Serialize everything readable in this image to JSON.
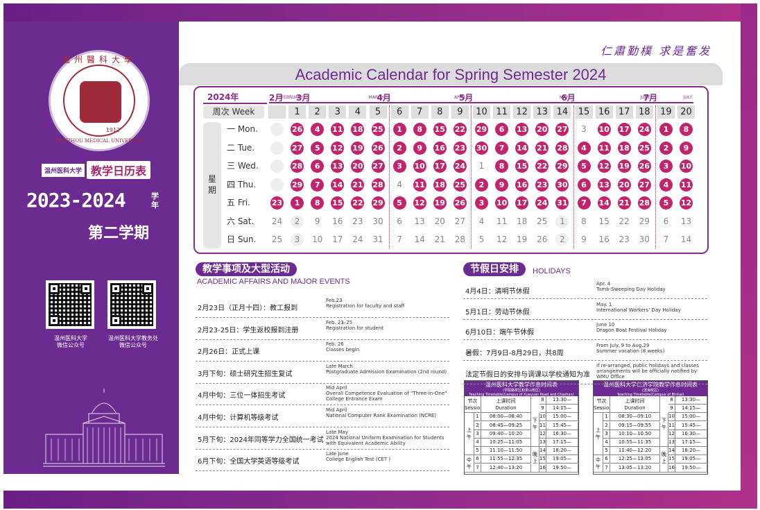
{
  "slogan": "仁肅勤樸  求是奮发",
  "side": {
    "seal_name_cn": "温州醫科大學",
    "seal_name_en": "WENZHOU MEDICAL UNIVERSITY",
    "seal_year": "1912",
    "tag_small": "温州医科大学",
    "tag_big": "教学日历表",
    "year_range": "2023-2024",
    "year_unit": "学年",
    "term": "第二学期",
    "qr_captions": [
      "温州医科大学\n微信公众号",
      "温州医科大学教务处\n微信公众号"
    ]
  },
  "calendar": {
    "title": "Academic Calendar for Spring Semester 2024",
    "year_label": "2024年",
    "week_label": "周次 Week",
    "side_label": "星期",
    "months": [
      {
        "cn": "2月",
        "en": "FEBRUARY"
      },
      {
        "cn": "3月",
        "en": "MARCH"
      },
      {
        "cn": "4月",
        "en": "APRIL"
      },
      {
        "cn": "5月",
        "en": "MAY"
      },
      {
        "cn": "6月",
        "en": "JUNE"
      },
      {
        "cn": "7月",
        "en": "JULY"
      }
    ],
    "weeks": [
      "",
      "1",
      "2",
      "3",
      "4",
      "5",
      "6",
      "7",
      "8",
      "9",
      "10",
      "11",
      "12",
      "13",
      "14",
      "15",
      "16",
      "17",
      "18",
      "19",
      "20"
    ],
    "day_names": [
      "一 Mon.",
      "二 Tue.",
      "三 Wed.",
      "四 Thu.",
      "五 Fri.",
      "六 Sat.",
      "日 Sun."
    ],
    "rows": [
      [
        "",
        "26",
        "4",
        "11",
        "18",
        "25",
        "1",
        "8",
        "15",
        "22",
        "29",
        "6",
        "13",
        "20",
        "27",
        "3",
        "10",
        "17",
        "24",
        "1",
        "8"
      ],
      [
        "",
        "27",
        "5",
        "12",
        "19",
        "26",
        "2",
        "9",
        "16",
        "23",
        "30",
        "7",
        "14",
        "21",
        "28",
        "4",
        "11",
        "18",
        "25",
        "2",
        "9"
      ],
      [
        "",
        "28",
        "6",
        "13",
        "20",
        "27",
        "3",
        "10",
        "17",
        "24",
        "1",
        "8",
        "15",
        "22",
        "29",
        "5",
        "12",
        "19",
        "26",
        "3",
        "10"
      ],
      [
        "",
        "29",
        "7",
        "14",
        "21",
        "28",
        "4",
        "11",
        "18",
        "25",
        "2",
        "9",
        "16",
        "23",
        "30",
        "6",
        "13",
        "20",
        "27",
        "4",
        "11"
      ],
      [
        "23",
        "1",
        "8",
        "15",
        "22",
        "29",
        "5",
        "12",
        "19",
        "26",
        "3",
        "10",
        "17",
        "24",
        "31",
        "7",
        "14",
        "21",
        "28",
        "5",
        "12"
      ],
      [
        "24",
        "2",
        "9",
        "16",
        "23",
        "30",
        "6",
        "13",
        "20",
        "27",
        "4",
        "11",
        "18",
        "25",
        "1",
        "8",
        "15",
        "22",
        "29",
        "6",
        "13"
      ],
      [
        "25",
        "3",
        "10",
        "17",
        "24",
        "31",
        "7",
        "14",
        "21",
        "28",
        "5",
        "12",
        "19",
        "26",
        "2",
        "9",
        "16",
        "23",
        "30",
        "7",
        "14"
      ]
    ]
  },
  "events": {
    "title_cn": "教学事项及大型活动",
    "title_en": "ACADEMIC AFFAIRS AND MAJOR EVENTS",
    "items": [
      {
        "cn": "2月23日（正月十四）：教工报到",
        "en": "Feb.23\nRegistration for faculty and staff"
      },
      {
        "cn": "2月23-25日：学生返校报到注册",
        "en": "Feb. 23–25\nRegistration for  student"
      },
      {
        "cn": "2月26日：正式上课",
        "en": "Feb. 26\nClasses begin"
      },
      {
        "cn": "3月下旬：硕士研究生招生复试",
        "en": "Late March\nPostgraduate Admission Examination (2nd round)"
      },
      {
        "cn": "4月中旬：三位一体招生考试",
        "en": "Mid April\nOverall Competence Evaluation of \"Three-in-One\"\nCollege Entrance  Exam"
      },
      {
        "cn": "4月中旬：计算机等级考试",
        "en": "Mid April\nNational Computer Rank Examination (NCRE)"
      },
      {
        "cn": "5月下旬：2024年同等学力全国统一考试",
        "en": "Late May\n2024 National Uniform Examination for Students\nwith Equivalent Academic Ability"
      },
      {
        "cn": "6月下旬：全国大学英语等级考试",
        "en": "Late June\nCollege English Test (CET )"
      }
    ]
  },
  "holidays": {
    "title_cn": "节假日安排",
    "title_en": "HOLIDAYS",
    "items": [
      {
        "cn": "4月4日：清明节休假",
        "en": "Apr. 4\nTomb-Sweeping Day Holiday"
      },
      {
        "cn": "5月1日：劳动节休假",
        "en": "May. 1\nInternational Workers' Day Holiday"
      },
      {
        "cn": "6月10日：端午节休假",
        "en": "June 10\nDragon Boat Festival Holiday"
      },
      {
        "cn": "暑假：7月9日-8月29日，共8周",
        "en": "From July. 9  to Aug.29\nSummer vocation  (8 weeks)"
      },
      {
        "cn": "法定节假日的安排与调课以学校通知为准",
        "en": "If re-arranged, public holidays and classes\narrangements will be officially notified by\nWMU Office"
      }
    ]
  },
  "timetables": [
    {
      "title": "温州医科大学教学作息时间表",
      "subtitle1": "(学院路校区和茶山校区)",
      "subtitle2": "Teaching Timetable(Campus of Xueyuan Road and Chashan)",
      "head": [
        "节次 Session",
        "上课时间 Duration"
      ],
      "am_label": "上午",
      "pm_label": "下午",
      "noon_label": "中午",
      "eve_label": "晚上",
      "left": [
        [
          "1",
          "08:00—08:40"
        ],
        [
          "2",
          "08:45—09:25"
        ],
        [
          "3",
          "09:40—10:20"
        ],
        [
          "4",
          "10:25—11:05"
        ],
        [
          "5",
          "11:10—11:50"
        ],
        [
          "6",
          "11:55—12:35"
        ],
        [
          "7",
          "12:40—13:20"
        ]
      ],
      "right": [
        [
          "8",
          "13:30—14:10"
        ],
        [
          "9",
          "14:15—14:55"
        ],
        [
          "10",
          "15:00—15:40"
        ],
        [
          "11",
          "15:45—16:25"
        ],
        [
          "12",
          "16:30—17:10"
        ],
        [
          "13",
          "17:15—17:55"
        ],
        [
          "14",
          "18:20—19:00"
        ],
        [
          "15",
          "19:05—19:45"
        ],
        [
          "16",
          "19:50—20:30"
        ]
      ]
    },
    {
      "title": "温州医科大学仁济学院教学作息时间表",
      "subtitle1": "(滨海校区)",
      "subtitle2": "Teaching Timetable(Campus of Binhai)",
      "head": [
        "节次 Session",
        "上课时间 Duration"
      ],
      "am_label": "上午",
      "pm_label": "下午",
      "noon_label": "中午",
      "eve_label": "晚上",
      "left": [
        [
          "1",
          "08:30—09:10"
        ],
        [
          "2",
          "09:15—09:55"
        ],
        [
          "3",
          "10:10—10:50"
        ],
        [
          "4",
          "10:55—11:35"
        ],
        [
          "5",
          "11:40—12:20"
        ],
        [
          "6",
          "12:25—13:05"
        ],
        [
          "7",
          "13:05—13:20"
        ]
      ],
      "right": [
        [
          "8",
          "13:30—14:10"
        ],
        [
          "9",
          "14:15—14:55"
        ],
        [
          "10",
          "15:00—15:40"
        ],
        [
          "11",
          "15:45—16:25"
        ],
        [
          "12",
          "16:30—17:10"
        ],
        [
          "13",
          "17:15—17:55"
        ],
        [
          "14",
          "18:20—19:00"
        ],
        [
          "15",
          "19:05—19:45"
        ],
        [
          "16",
          "19:50—20:30"
        ]
      ]
    }
  ]
}
